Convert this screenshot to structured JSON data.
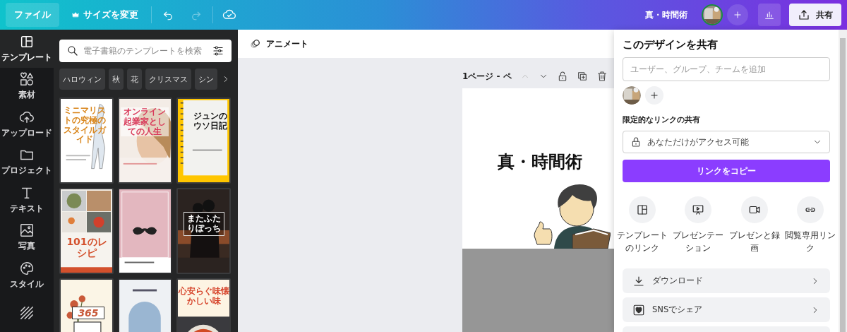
{
  "topbar": {
    "file_button": "ファイル",
    "resize_button": "サイズを変更",
    "undo_disabled": false,
    "redo_disabled": true,
    "design_title": "真・時間術",
    "share_button": "共有"
  },
  "sidebar": {
    "items": [
      {
        "kind": "template",
        "label": "テンプレート",
        "selected": true
      },
      {
        "kind": "elements",
        "label": "素材",
        "selected": false
      },
      {
        "kind": "upload",
        "label": "アップロード",
        "selected": false
      },
      {
        "kind": "folder",
        "label": "プロジェクト",
        "selected": false
      },
      {
        "kind": "text",
        "label": "テキスト",
        "selected": false
      },
      {
        "label": "写真",
        "selected": false
      },
      {
        "kind": "style",
        "label": "スタイル",
        "selected": false
      },
      {
        "kind": "pattern",
        "selected": false
      }
    ]
  },
  "template_panel": {
    "search": {
      "placeholder": "電子書籍のテンプレートを検索"
    },
    "chips": [
      "ハロウィン",
      "秋",
      "花",
      "クリスマス",
      "シン"
    ],
    "templates": [
      {
        "title": "ミニマリストの究極のスタイルガイド"
      },
      {
        "title": "オンライン起業家としての人生"
      },
      {
        "title": "ジュンのウソ日記"
      },
      {
        "title": "101のレシピ"
      },
      {
        "kind": "picture"
      },
      {
        "title": "またふたりぼっち"
      },
      {
        "title": "365"
      },
      {
        "kind": "picture"
      },
      {
        "title": "心安らぐ味懐かしい味"
      }
    ]
  },
  "editor": {
    "animate_button": "アニメート",
    "page_label": "1ページ - ペ",
    "page_up_disabled": true,
    "page_heading": "真・時間術"
  },
  "share_panel": {
    "title": "このデザインを共有",
    "people_field": {
      "placeholder": "ユーザー、グループ、チームを追加"
    },
    "link_heading": "限定的なリンクの共有",
    "access": "あなただけがアクセス可能",
    "copy_button": "リンクをコピー",
    "options": [
      {
        "kind": "template",
        "label": "テンプレートのリンク"
      },
      {
        "kind": "present",
        "label": "プレゼンテーション"
      },
      {
        "kind": "record",
        "label": "プレゼンと録画"
      },
      {
        "kind": "link",
        "label": "閲覧専用リンク"
      }
    ],
    "actions": [
      {
        "kind": "download",
        "label": "ダウンロード"
      },
      {
        "kind": "social",
        "label": "SNSでシェア"
      }
    ]
  }
}
